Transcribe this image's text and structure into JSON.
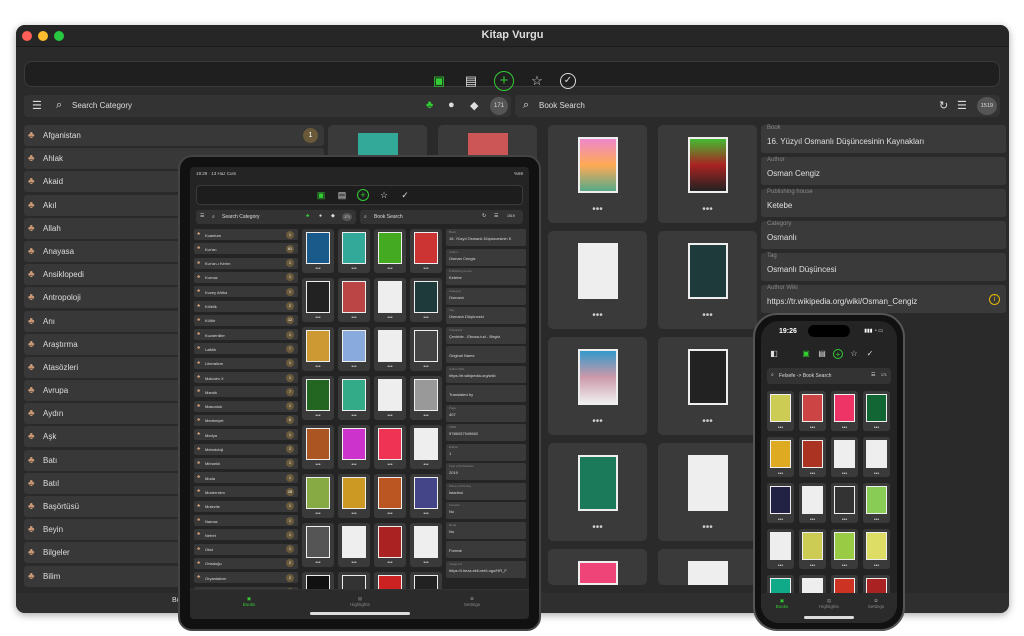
{
  "window": {
    "title": "Kitap Vurgu"
  },
  "toolbar": {
    "icons": [
      "book-icon",
      "library-icon",
      "add-icon",
      "star-icon",
      "checkmark-icon"
    ]
  },
  "desktop": {
    "left_search": {
      "placeholder": "Search Category"
    },
    "total_count": "171",
    "right_search": {
      "placeholder": "Book Search"
    },
    "book_count": "1519",
    "categories": [
      {
        "label": "Afganistan",
        "count": "1"
      },
      {
        "label": "Ahlak",
        "count": ""
      },
      {
        "label": "Akaid",
        "count": ""
      },
      {
        "label": "Akıl",
        "count": ""
      },
      {
        "label": "Allah",
        "count": ""
      },
      {
        "label": "Anayasa",
        "count": ""
      },
      {
        "label": "Ansiklopedi",
        "count": ""
      },
      {
        "label": "Antropoloji",
        "count": ""
      },
      {
        "label": "Anı",
        "count": ""
      },
      {
        "label": "Araştırma",
        "count": ""
      },
      {
        "label": "Atasözleri",
        "count": ""
      },
      {
        "label": "Avrupa",
        "count": ""
      },
      {
        "label": "Aydın",
        "count": ""
      },
      {
        "label": "Aşk",
        "count": ""
      },
      {
        "label": "Batı",
        "count": ""
      },
      {
        "label": "Batıl",
        "count": ""
      },
      {
        "label": "Başörtüsü",
        "count": ""
      },
      {
        "label": "Beyin",
        "count": ""
      },
      {
        "label": "Bilgeler",
        "count": ""
      },
      {
        "label": "Bilim",
        "count": ""
      }
    ],
    "detail": [
      {
        "label": "Book",
        "value": "16. Yüzyıl Osmanlı Düşüncesinin Kaynakları"
      },
      {
        "label": "Author",
        "value": "Osman Cengiz"
      },
      {
        "label": "Publishing house",
        "value": "Ketebe"
      },
      {
        "label": "Category",
        "value": "Osmanlı"
      },
      {
        "label": "Tag",
        "value": "Osmanlı Düşüncesi"
      },
      {
        "label": "Author Wiki",
        "value": "https://tr.wikipedia.org/wiki/Osman_Cengiz"
      }
    ],
    "bottom_tab": "Books",
    "more": "•••"
  },
  "tablet": {
    "status": {
      "time": "19:29 · 13 Haz Cum",
      "battery": "%69"
    },
    "left_search": "Search Category",
    "right_search": "Book Search",
    "total_count": "171",
    "book_count": "1519",
    "categories": [
      {
        "label": "Kuantum",
        "count": "1"
      },
      {
        "label": "Kur'an",
        "count": "61"
      },
      {
        "label": "Kur'an-ı Kerim",
        "count": "1"
      },
      {
        "label": "Kurnaz",
        "count": "1"
      },
      {
        "label": "Kuzey Afrika",
        "count": "1"
      },
      {
        "label": "Kölelik",
        "count": "2"
      },
      {
        "label": "Kültür",
        "count": "12"
      },
      {
        "label": "Kuzdenliler",
        "count": "1"
      },
      {
        "label": "Laiklik",
        "count": "7"
      },
      {
        "label": "Liberalizm",
        "count": "1"
      },
      {
        "label": "Malcolm X",
        "count": "1"
      },
      {
        "label": "Mantık",
        "count": "7"
      },
      {
        "label": "Masonluk",
        "count": "1"
      },
      {
        "label": "Medeniyet",
        "count": "6"
      },
      {
        "label": "Medya",
        "count": "1"
      },
      {
        "label": "Metodoloji",
        "count": "2"
      },
      {
        "label": "Mimarlık",
        "count": "1"
      },
      {
        "label": "Moda",
        "count": "1"
      },
      {
        "label": "Modernizm",
        "count": "28"
      },
      {
        "label": "Mutezile",
        "count": "1"
      },
      {
        "label": "Namaz",
        "count": "1"
      },
      {
        "label": "Nefret",
        "count": "1"
      },
      {
        "label": "Okul",
        "count": "1"
      },
      {
        "label": "Ortadoğu",
        "count": "2"
      },
      {
        "label": "Oryantalizm",
        "count": "2"
      },
      {
        "label": "Osmanlı",
        "count": "6"
      }
    ],
    "detail": [
      {
        "label": "Book",
        "value": "16. Yüzyıl Osmanlı Düşüncesinin K"
      },
      {
        "label": "Author",
        "value": "Osman Cengiz"
      },
      {
        "label": "Publishing house",
        "value": "Ketebe"
      },
      {
        "label": "Category",
        "value": "Osmanlı"
      },
      {
        "label": "Tag",
        "value": "Osmanlı Düşüncesi"
      },
      {
        "label": "Translator",
        "value": "Çeviride - Ebussu'ud - Birgivi"
      },
      {
        "label": "",
        "value": "Original Name"
      },
      {
        "label": "Author Wiki",
        "value": "https://tr.wikipedia.org/wiki"
      },
      {
        "label": "",
        "value": "Translated by"
      },
      {
        "label": "Page",
        "value": "407"
      },
      {
        "label": "ISBN",
        "value": "9786057949660"
      },
      {
        "label": "Edition",
        "value": "1"
      },
      {
        "label": "Year of Publication",
        "value": "2019"
      },
      {
        "label": "Place of Printing",
        "value": "İstanbul"
      },
      {
        "label": "Favorite",
        "value": "No"
      },
      {
        "label": "Read",
        "value": "No"
      },
      {
        "label": "",
        "value": "Format"
      },
      {
        "label": "Image Url",
        "value": "https://i.imza.ekli.net/Logo/HR_F"
      }
    ],
    "tabs": [
      {
        "label": "Books"
      },
      {
        "label": "Highlights"
      },
      {
        "label": "Settings"
      }
    ]
  },
  "phone": {
    "time": "19:26",
    "search": "Felsefe -> Book Search",
    "count": "171",
    "tabs": [
      {
        "label": "Books"
      },
      {
        "label": "Highlights"
      },
      {
        "label": "Settings"
      }
    ]
  },
  "colors": {
    "accent": "#33cc33",
    "background": "#2a2a2a",
    "row": "#383838",
    "category_icon": "#cc9977",
    "info": "#e6b800"
  }
}
